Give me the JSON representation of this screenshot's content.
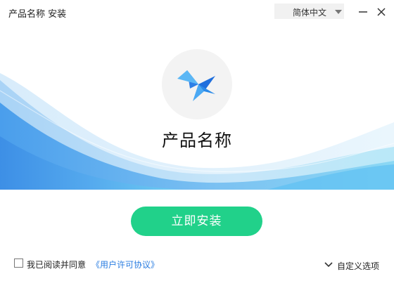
{
  "window": {
    "title": "产品名称 安装",
    "language": {
      "selected": "简体中文"
    },
    "controls": {
      "minimize": "minimize-icon",
      "close": "close-icon"
    }
  },
  "hero": {
    "logo_icon": "pinwheel-logo-icon",
    "product_name": "产品名称"
  },
  "actions": {
    "install_label": "立即安装"
  },
  "footer": {
    "agreement_prefix": "我已阅读并同意",
    "license_link": "《用户许可协议》",
    "agreement_checked": false,
    "custom_options_label": "自定义选项"
  },
  "colors": {
    "accent_green": "#21d18a",
    "link_blue": "#2a7de1",
    "wave_blue": "#4da3ee"
  }
}
